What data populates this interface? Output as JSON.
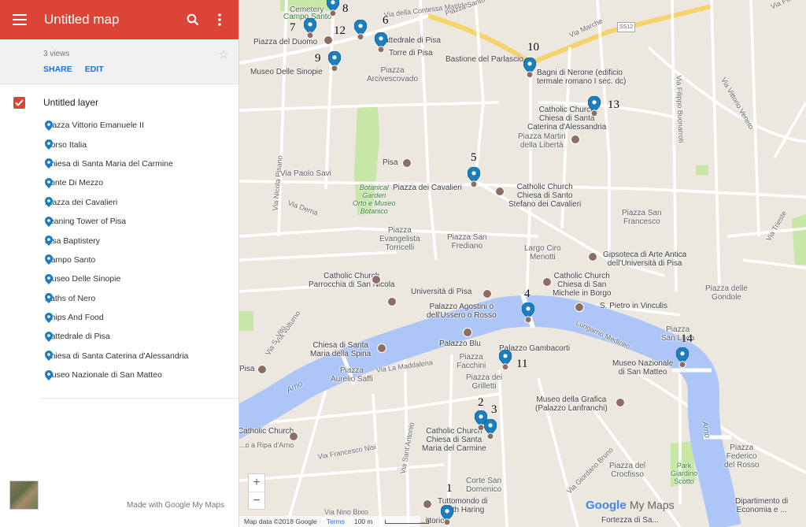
{
  "header": {
    "title": "Untitled map"
  },
  "meta": {
    "views": "3 views",
    "share_label": "SHARE",
    "edit_label": "EDIT"
  },
  "layer": {
    "title": "Untitled layer",
    "checked": true,
    "places": [
      "Piazza Vittorio Emanuele II",
      "Corso Italia",
      "Chiesa di Santa Maria del Carmine",
      "Ponte Di Mezzo",
      "Piazza dei Cavalieri",
      "Leaning Tower of Pisa",
      "Pisa Baptistery",
      "Campo Santo",
      "Museo Delle Sinopie",
      "Baths of Nero",
      "Chips And Food",
      "Cattedrale di Pisa",
      "Chiesa di Santa Caterina d'Alessandria",
      "Museo Nazionale di San Matteo"
    ]
  },
  "footer_sidebar": {
    "made_with": "Made with Google My Maps"
  },
  "map": {
    "marker_numbers": [
      "1",
      "2",
      "3",
      "4",
      "5",
      "6",
      "7",
      "8",
      "9",
      "10",
      "11",
      "12",
      "13",
      "14"
    ],
    "labels": {
      "cemetery": "Cemetery",
      "campo_santo": "Campo Santo",
      "piazza_duomo": "Piazza del Duomo",
      "cattedrale": "Cattedrale di Pisa",
      "torre": "Torre di Pisa",
      "museo_sinopie": "Museo Delle Sinopie",
      "piazza_arcivescovado": "Piazza\nArcivescovado",
      "bastione": "Bastione del Parlascio",
      "bagni": "Bagni di Nerone (edificio\ntermale romano I sec. dc)",
      "catholic_caterina": "Catholic Church\nChiesa di Santa\nCaterina d'Alessandria",
      "piazza_martiri": "Piazza Martiri\ndella Libertà",
      "pisa_north": "Pisa",
      "botanical": "Botanical\nGarden\nOrto e Museo\nBotanico",
      "piazza_cavalieri": "Piazza dei Cavalieri",
      "catholic_stefano": "Catholic Church\nChiesa di Santo\nStefano dei Cavalieri",
      "via_paolo_savi": "Via Paolo Savi",
      "piazza_san_francesco": "Piazza San\nFrancesco",
      "piazza_evangelista": "Piazza\nEvangelista\nTorricelli",
      "piazza_frediano": "Piazza San\nFrediano",
      "largo_ciro": "Largo Ciro\nMenotti",
      "gipsoteca": "Gipsoteca di Arte Antica\ndell'Università di Pisa",
      "catholic_nicola": "Catholic Church\nParrocchia di San Nicola",
      "universita": "Università di Pisa",
      "catholic_michele": "Catholic Church\nChiesa di San\nMichele in Borgo",
      "piazza_gondole": "Piazza delle\nGondole",
      "s_pietro": "S. Pietro in Vinculis",
      "palazzo_agostini": "Palazzo Agostini o\ndell'Ussero o Rosso",
      "piazza_luca": "Piazza\nSan Luca",
      "chiesa_spina": "Chiesa di Santa\nMaria della Spina",
      "palazzo_blu": "Palazzo Blu",
      "palazzo_gambacorti": "Palazzo Gambacorti",
      "piazza_facchini": "Piazza\nFacchini",
      "museo_san_matteo": "Museo Nazionale\ndi San Matteo",
      "pisa_west": "Pisa",
      "piazza_aurelio": "Piazza\nAurelio Saffi",
      "piazza_grilletti": "Piazza dei\nGrilletti",
      "museo_grafica": "Museo della Grafica\n(Palazzo Lanfranchi)",
      "catholic_west": "Catholic Church",
      "catholic_carmine": "Catholic Church\nChiesa di Santa\nMaria del Carmine",
      "piazza_federico": "Piazza\nFederico\ndel Rosso",
      "park_giardino": "Park\nGiardino\nScotto",
      "piazza_crocfisso": "Piazza del\nCrocfisso",
      "corte_san_domenico": "Corte San\nDomenico",
      "tuttomondo": "Tuttomondo di\nKeith Haring",
      "dipartimento": "Dipartimento di\nEconomia e ...",
      "fortezza": "Fortezza di Sa...",
      "vittorio": "...ittorio",
      "arno_west": "Arno",
      "arno_east": "Arno",
      "lungarno_mediceo": "Lungarno Mediceo",
      "via_la_maddalena": "Via La Maddalena",
      "via_francesco_nisi": "Via Francesco Nisi",
      "via_nino_bixio": "Via Nino Bixio",
      "via_della_contessa": "Via della Contessa Matilde",
      "piazza_santo_stefano": "Piazza Santo Stefano",
      "via_marche": "Via Marche",
      "via_bonanno": "Via Filippo Buonarroti",
      "via_vittorio_veneto": "Via Vittorio Veneto",
      "via_derna": "Via Derna",
      "via_nicola_pisano": "Via Nicola Pisano",
      "via_volturno": "Via Volturno",
      "via_s_vito": "Via S. Vito",
      "via_bruno": "Via Giordano Bruno",
      "via_s_antonio": "Via Sant'Antonio",
      "via_ripa": "...o a Ripa d'Arno",
      "ss12": "SS12",
      "via_trieste": "Via Trieste",
      "via_fil": "Via Fil..."
    }
  },
  "attribution": {
    "data": "Map data ©2018 Google",
    "terms": "Terms",
    "scale": "100 m"
  },
  "brand": {
    "google": "Google",
    "my_maps": "My Maps"
  },
  "colors": {
    "header": "#db4437",
    "pin": "#1b7fbf",
    "river": "#aec6f7",
    "park": "#c8e6a5"
  }
}
